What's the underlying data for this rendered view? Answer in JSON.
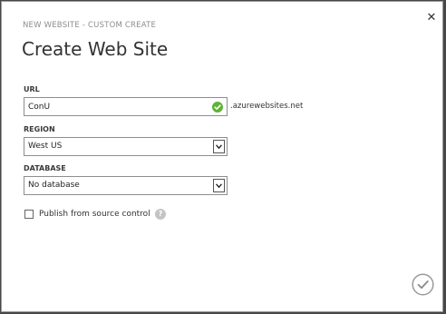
{
  "dialog": {
    "subtitle": "NEW WEBSITE - CUSTOM CREATE",
    "title": "Create Web Site",
    "close_icon": "close-icon",
    "ok_icon": "check-circle-icon"
  },
  "url": {
    "label": "URL",
    "value": "ConU",
    "suffix": ".azurewebsites.net",
    "valid_icon": "green-check-icon",
    "valid_color": "#5fb336"
  },
  "region": {
    "label": "REGION",
    "selected": "West US"
  },
  "database": {
    "label": "DATABASE",
    "selected": "No database"
  },
  "publish": {
    "label": "Publish from source control",
    "checked": false,
    "help_icon": "question-mark-icon"
  }
}
